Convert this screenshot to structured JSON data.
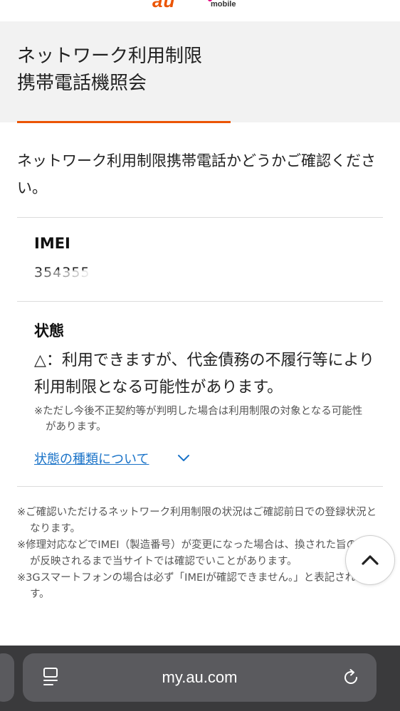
{
  "header": {
    "logo_text": "au",
    "logo_sub": "mobile",
    "title_line1": "ネットワーク利用制限",
    "title_line2": "携帯電話機照会"
  },
  "intro": {
    "text": "ネットワーク利用制限携帯電話かどうかご確認ください。"
  },
  "imei": {
    "label": "IMEI",
    "value": "354355"
  },
  "status": {
    "label": "状態",
    "text": "△：利用できますが、代金債務の不履行等により利用制限となる可能性があります。",
    "note": "※ただし今後不正契約等が判明した場合は利用制限の対象となる可能性があります。",
    "link_label": "状態の種類について"
  },
  "notes": [
    "※ご確認いただけるネットワーク利用制限の状況はご確認前日での登録状況となります。",
    "※修理対応などでIMEI（製造番号）が変更になった場合は、換された旨の情報が反映されるまで当サイトでは確認でいことがあります。",
    "※3Gスマートフォンの場合は必ず「IMEIが確認できません。」と表記されます。"
  ],
  "browser": {
    "url": "my.au.com"
  },
  "colors": {
    "accent": "#eb5505",
    "link": "#1a73c8",
    "band": "#f2f2f2",
    "browser_bar": "#3a3a3c"
  },
  "icons": {
    "scroll_top": "chevron-up-icon",
    "link_toggle": "chevron-down-icon",
    "reader": "reader-mode-icon",
    "reload": "reload-icon"
  }
}
